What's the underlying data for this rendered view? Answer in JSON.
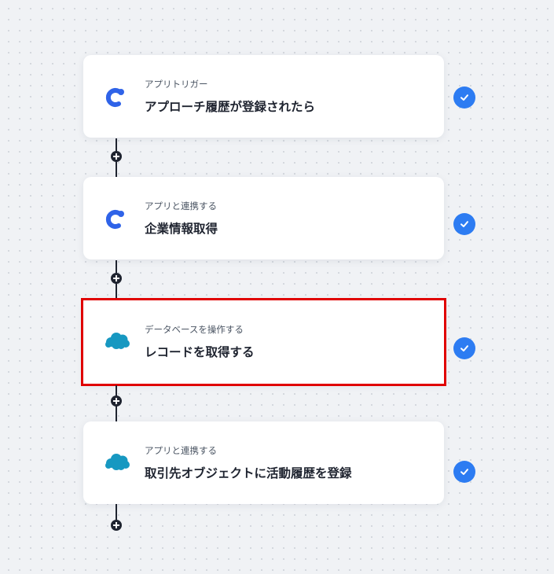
{
  "accent_color": "#2d7cf2",
  "selected_border_color": "#e00000",
  "steps": [
    {
      "subtitle": "アプリトリガー",
      "title": "アプローチ履歴が登録されたら",
      "app_icon": "brand-c-icon",
      "status": "completed",
      "selected": false
    },
    {
      "subtitle": "アプリと連携する",
      "title": "企業情報取得",
      "app_icon": "brand-c-icon",
      "status": "completed",
      "selected": false
    },
    {
      "subtitle": "データベースを操作する",
      "title": "レコードを取得する",
      "app_icon": "salesforce-cloud-icon",
      "status": "completed",
      "selected": true
    },
    {
      "subtitle": "アプリと連携する",
      "title": "取引先オブジェクトに活動履歴を登録",
      "app_icon": "salesforce-cloud-icon",
      "status": "completed",
      "selected": false
    }
  ]
}
